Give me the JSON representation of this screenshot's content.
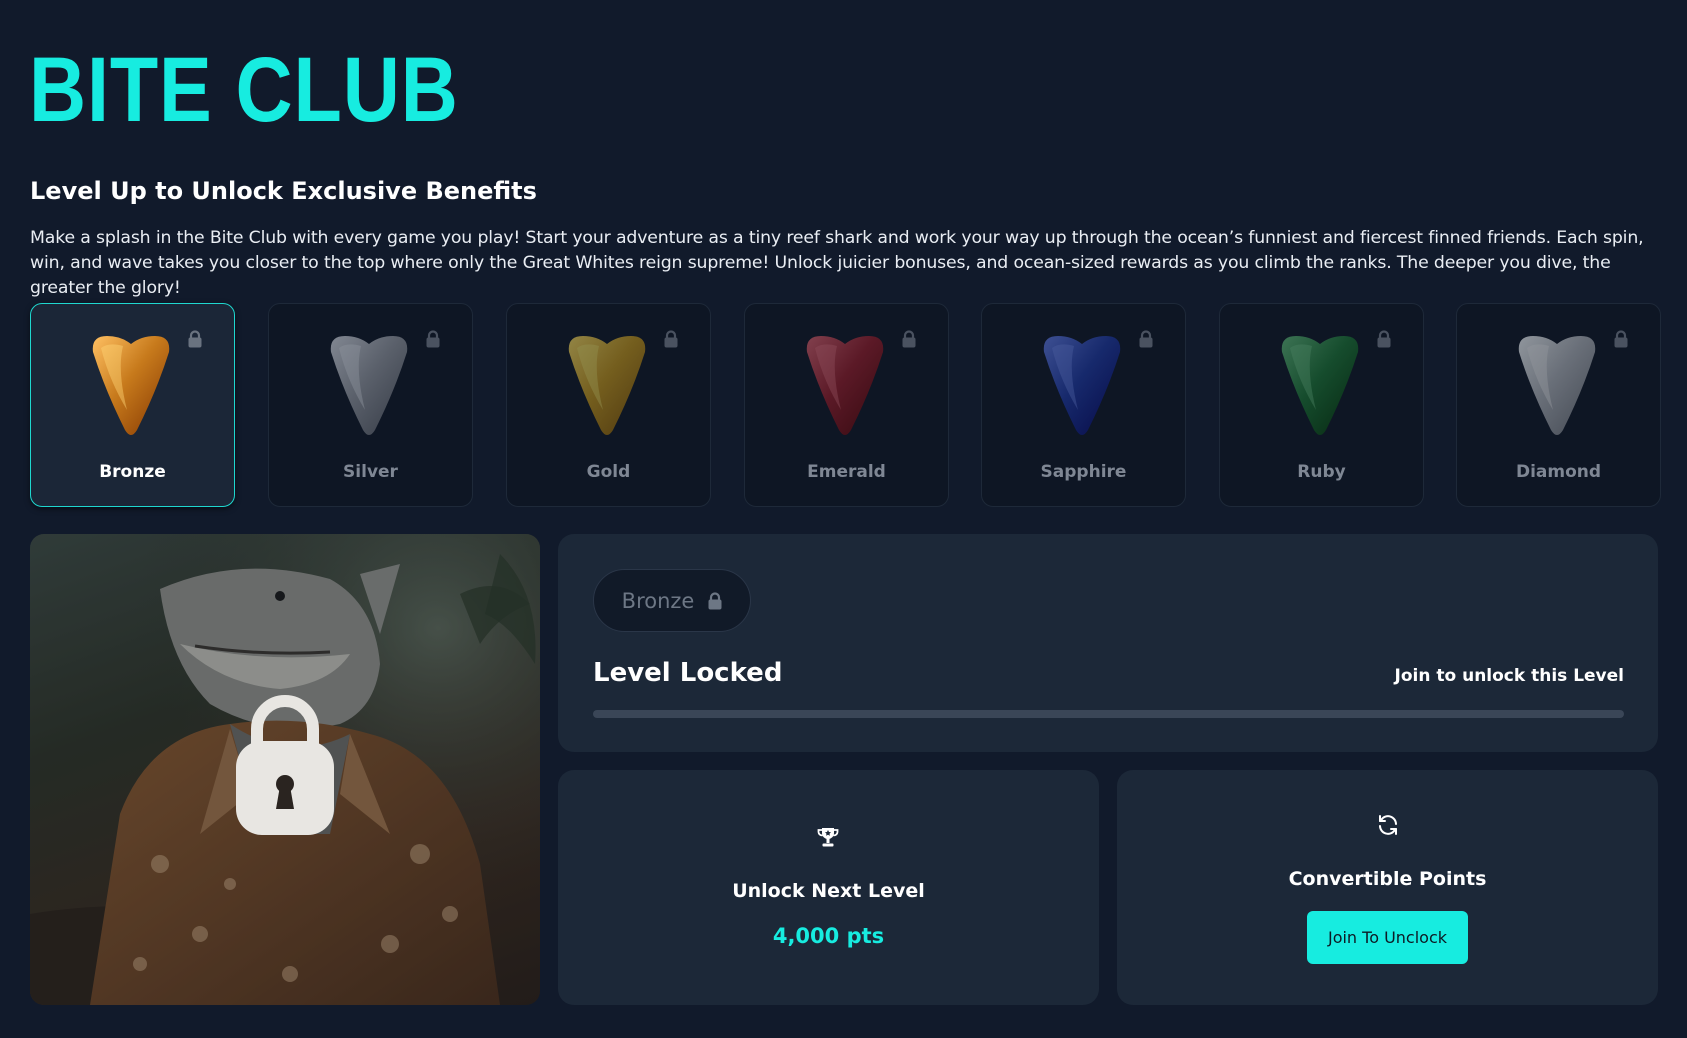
{
  "header": {
    "title": "BITE CLUB",
    "subtitle": "Level Up to Unlock Exclusive Benefits",
    "description": "Make a splash in the Bite Club with every game you play! Start your adventure as a tiny reef shark and work your way up through the ocean’s funniest and fiercest finned friends. Each spin, win, and wave takes you closer to the top where only the Great Whites reign supreme! Unlock juicier bonuses, and ocean-sized rewards as you climb the ranks. The deeper you dive, the greater the glory!"
  },
  "tiers": [
    {
      "label": "Bronze",
      "color": "#c77a1c",
      "selected": true,
      "locked": true
    },
    {
      "label": "Silver",
      "color": "#9a9ea6",
      "selected": false,
      "locked": true
    },
    {
      "label": "Gold",
      "color": "#c99a1a",
      "selected": false,
      "locked": true
    },
    {
      "label": "Emerald",
      "color": "#9b1d2a",
      "selected": false,
      "locked": true
    },
    {
      "label": "Sapphire",
      "color": "#1f3aa8",
      "selected": false,
      "locked": true
    },
    {
      "label": "Ruby",
      "color": "#1d7a36",
      "selected": false,
      "locked": true
    },
    {
      "label": "Diamond",
      "color": "#b4b8be",
      "selected": false,
      "locked": true
    }
  ],
  "level_panel": {
    "pill_label": "Bronze",
    "status": "Level Locked",
    "join_text": "Join to unlock this Level",
    "progress": 0
  },
  "next_level_card": {
    "icon": "trophy-icon",
    "title": "Unlock Next Level",
    "points": "4,000 pts"
  },
  "convertible_card": {
    "icon": "refresh-icon",
    "title": "Convertible Points",
    "button_label": "Join To Unclock"
  },
  "colors": {
    "accent": "#17ece0",
    "background": "#111a2b",
    "panel": "#1c2838"
  }
}
